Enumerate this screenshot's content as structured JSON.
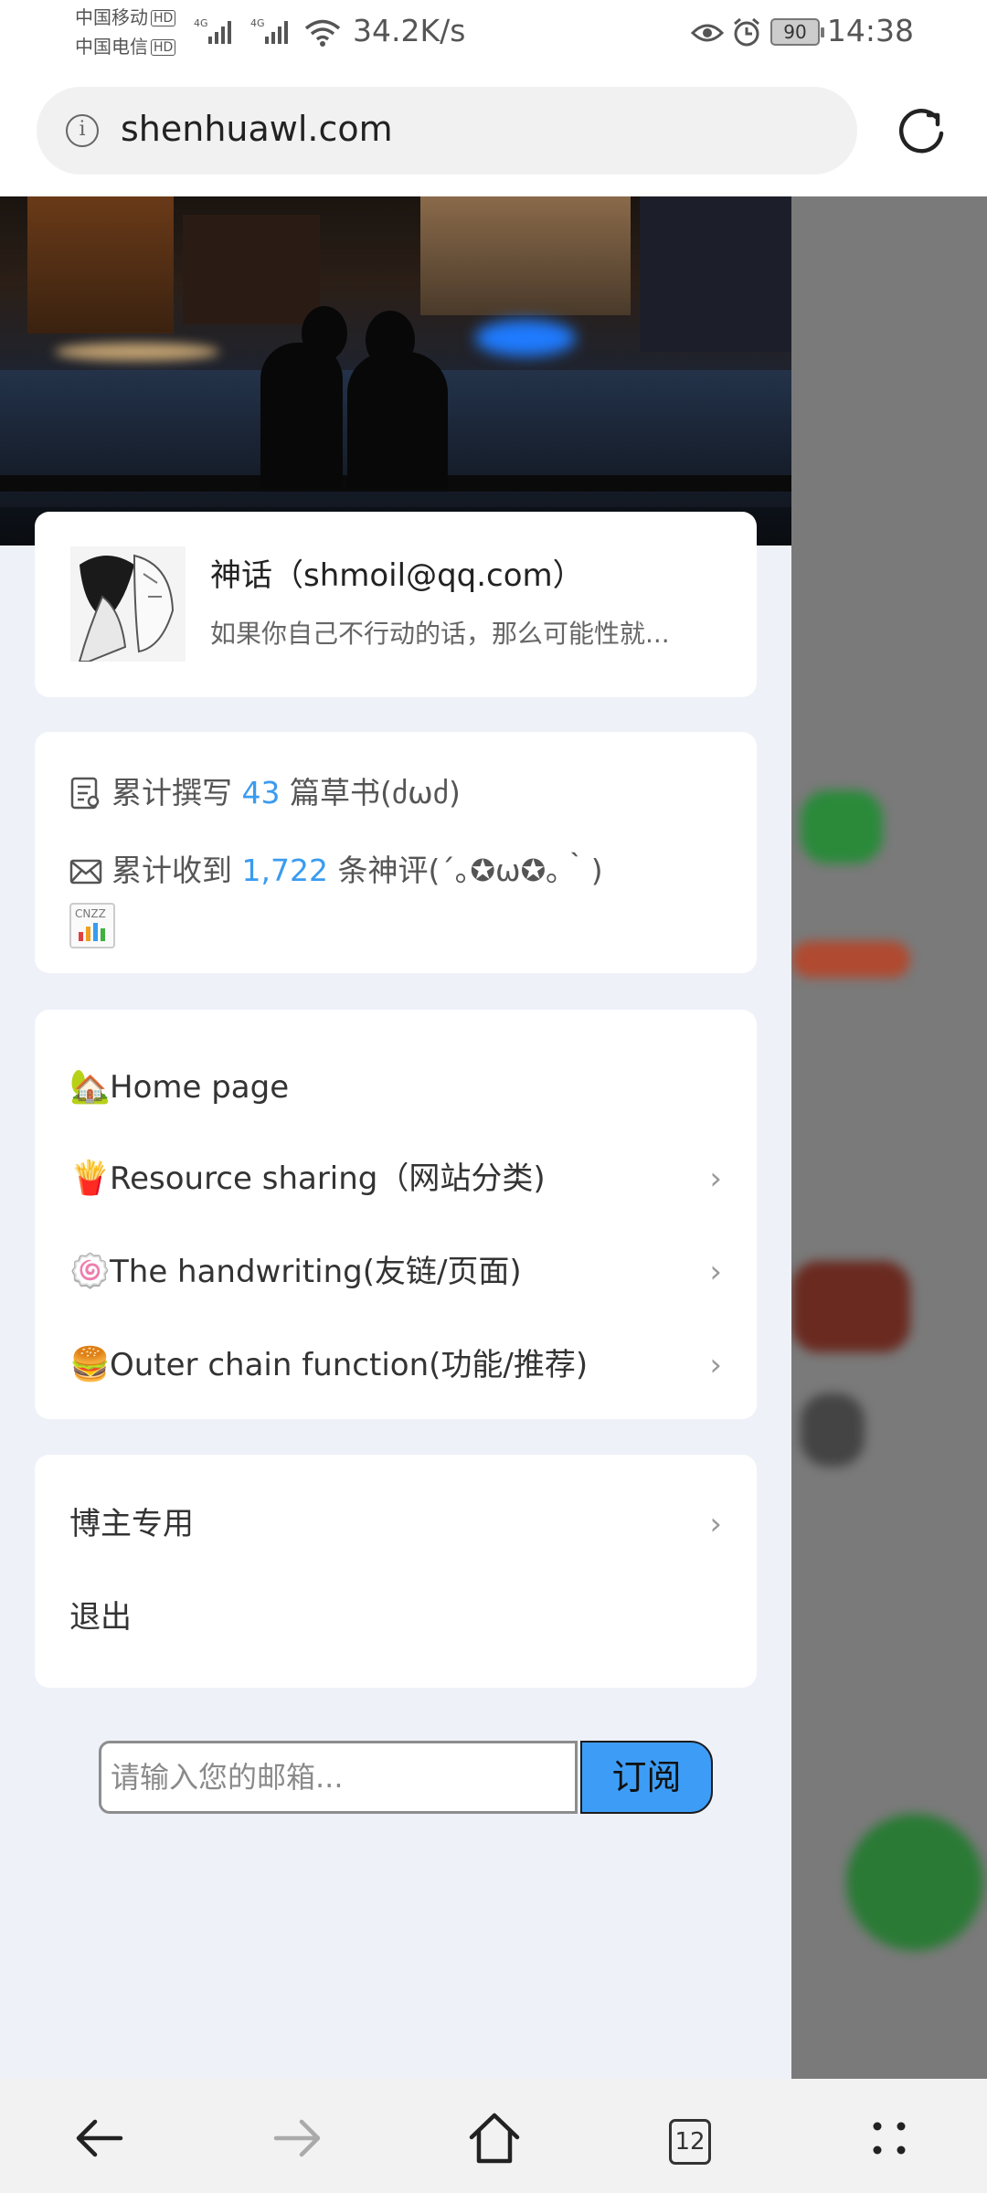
{
  "status_bar": {
    "carrier1": "中国移动",
    "carrier2": "中国电信",
    "hd": "HD",
    "network1": "4G",
    "network2": "4G",
    "speed": "34.2K/s",
    "battery": "90",
    "time": "14:38"
  },
  "browser": {
    "url": "shenhuawl.com",
    "tab_count": "12"
  },
  "profile": {
    "name": "神话（shmoil@qq.com）",
    "motto": "如果你自己不行动的话，那么可能性就..."
  },
  "stats": {
    "posts_prefix": "累计撰写",
    "posts_count": "43",
    "posts_suffix": "篇草书(ძωძ)",
    "comments_prefix": "累计收到",
    "comments_count": "1,722",
    "comments_suffix": "条神评(´｡✪ω✪｡｀)",
    "cnzz_label": "CNZZ"
  },
  "menu": [
    {
      "emoji": "🏡",
      "label": "Home page",
      "has_arrow": false
    },
    {
      "emoji": "🍟",
      "label": "Resource sharing（网站分类)",
      "has_arrow": true
    },
    {
      "emoji": "🍥",
      "label": "The handwriting(友链/页面)",
      "has_arrow": true
    },
    {
      "emoji": "🍔",
      "label": "Outer chain function(功能/推荐)",
      "has_arrow": true
    }
  ],
  "admin": {
    "blogger_label": "博主专用",
    "logout_label": "退出"
  },
  "subscribe": {
    "placeholder": "请输入您的邮箱...",
    "button": "订阅"
  },
  "icons": {
    "info": "info-icon",
    "reload": "reload-icon",
    "back": "back-arrow-icon",
    "forward": "forward-arrow-icon",
    "home": "home-icon",
    "more": "more-dots-icon",
    "chevron": "›"
  },
  "colors": {
    "accent": "#3a9bf0",
    "subscribe_button": "#3d9df6",
    "drawer_bg": "#eef1f8"
  }
}
